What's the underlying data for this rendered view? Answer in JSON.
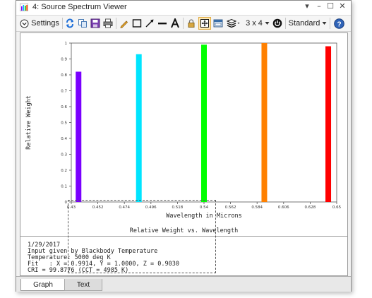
{
  "window": {
    "title": "4: Source Spectrum Viewer",
    "controls": [
      "▾",
      "–",
      "☐",
      "✕"
    ]
  },
  "toolbar": {
    "settings_label": "Settings",
    "layout_label": "3 x 4",
    "mode_label": "Standard"
  },
  "chart_data": {
    "type": "bar",
    "xlabel": "Wavelength in Microns",
    "ylabel": "Relative Weight",
    "title": "Relative Weight vs. Wavelength",
    "xlim": [
      0.43,
      0.65
    ],
    "ylim": [
      0,
      1
    ],
    "x_ticks": [
      "0.43",
      "0.452",
      "0.474",
      "0.496",
      "0.518",
      "0.54",
      "0.562",
      "0.584",
      "0.606",
      "0.628",
      "0.65"
    ],
    "y_ticks": [
      "0",
      "0.1",
      "0.2",
      "0.3",
      "0.4",
      "0.5",
      "0.6",
      "0.7",
      "0.8",
      "0.9",
      "1"
    ],
    "grid": false,
    "bars": [
      {
        "x": 0.436,
        "value": 0.82,
        "color": "#7a00ff"
      },
      {
        "x": 0.486,
        "value": 0.93,
        "color": "#00e5ff"
      },
      {
        "x": 0.54,
        "value": 0.99,
        "color": "#00ff00"
      },
      {
        "x": 0.59,
        "value": 1.0,
        "color": "#ff8000"
      },
      {
        "x": 0.643,
        "value": 0.98,
        "color": "#ff0000"
      }
    ]
  },
  "info": {
    "lines": [
      "1/29/2017",
      "Input given by Blackbody Temperature",
      "Temperature: 5000 deg K",
      "Fit   : X = 0.9914, Y = 1.0000, Z = 0.9030",
      "CRI = 99.8776 (CCT = 4985 K)"
    ]
  },
  "tabs": [
    {
      "label": "Graph",
      "active": true
    },
    {
      "label": "Text",
      "active": false
    }
  ]
}
